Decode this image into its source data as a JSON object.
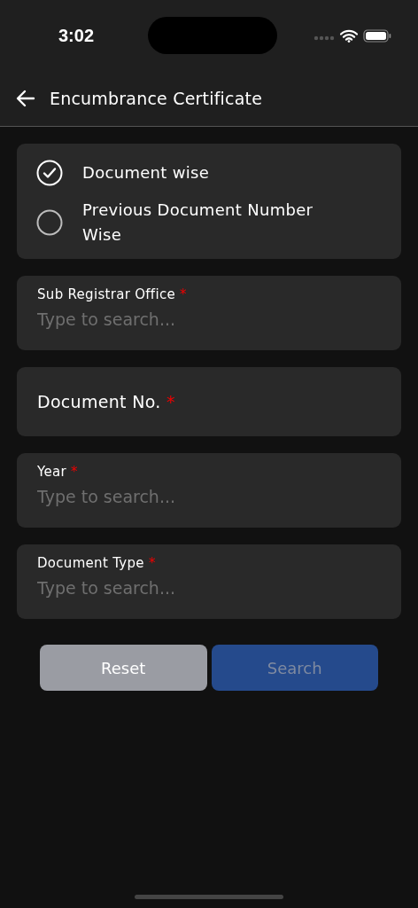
{
  "status_bar": {
    "time": "3:02"
  },
  "header": {
    "title": "Encumbrance Certificate"
  },
  "search_options": [
    {
      "label": "Document wise",
      "selected": true
    },
    {
      "label": "Previous Document Number Wise",
      "selected": false
    }
  ],
  "fields": [
    {
      "kind": "search",
      "label": "Sub Registrar Office",
      "required_mark": "*",
      "placeholder": "Type to search..."
    },
    {
      "kind": "text",
      "label": "Document No.",
      "required_mark": "*"
    },
    {
      "kind": "search",
      "label": "Year",
      "required_mark": "*",
      "placeholder": "Type to search..."
    },
    {
      "kind": "search",
      "label": "Document Type",
      "required_mark": "*",
      "placeholder": "Type to search..."
    }
  ],
  "buttons": [
    {
      "label": "Reset",
      "kind": "secondary",
      "disabled": false
    },
    {
      "label": "Search",
      "kind": "primary",
      "disabled": true
    }
  ]
}
